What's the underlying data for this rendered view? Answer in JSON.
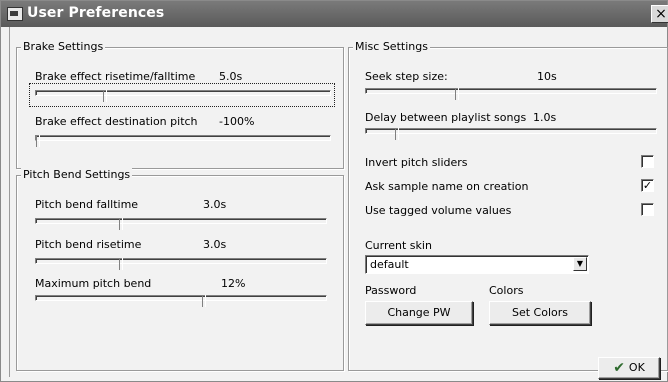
{
  "window": {
    "title": "User Preferences",
    "close_glyph": "×"
  },
  "brake": {
    "group_title": "Brake Settings",
    "rows": [
      {
        "label": "Brake effect risetime/falltime",
        "value": "5.0s",
        "level": 0.23
      },
      {
        "label": "Brake effect destination pitch",
        "value": "-100%",
        "level": 0.0
      }
    ]
  },
  "pitch": {
    "group_title": "Pitch Bend Settings",
    "rows": [
      {
        "label": "Pitch bend falltime",
        "value": "3.0s",
        "level": 0.29
      },
      {
        "label": "Pitch bend risetime",
        "value": "3.0s",
        "level": 0.29
      },
      {
        "label": "Maximum pitch bend",
        "value": "12%",
        "level": 0.58
      }
    ]
  },
  "misc": {
    "group_title": "Misc Settings",
    "rows": [
      {
        "label": "Seek step size:",
        "value": "10s",
        "level": 0.31
      },
      {
        "label": "Delay between playlist songs",
        "value": "1.0s",
        "level": 0.1
      }
    ],
    "checkboxes": [
      {
        "label": "Invert pitch sliders",
        "checked": false
      },
      {
        "label": "Ask sample name on creation",
        "checked": true
      },
      {
        "label": "Use tagged volume values",
        "checked": false
      }
    ],
    "skin": {
      "label": "Current skin",
      "value": "default",
      "arrow": "▼"
    },
    "password": {
      "label": "Password",
      "button": "Change PW"
    },
    "colors": {
      "label": "Colors",
      "button": "Set Colors"
    }
  },
  "ok_button": {
    "label": "OK",
    "check_glyph": "✔"
  }
}
